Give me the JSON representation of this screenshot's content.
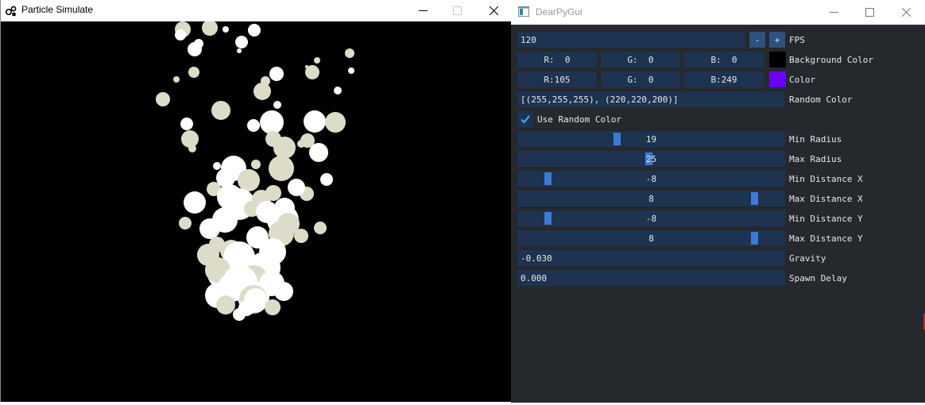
{
  "left_window": {
    "title": "Particle Simulate",
    "controls": [
      "minimize",
      "maximize",
      "close"
    ]
  },
  "right_window": {
    "title": "DearPyGui",
    "fps": {
      "value": "120",
      "minus_label": "-",
      "plus_label": "+",
      "label": "FPS"
    },
    "background_color": {
      "r": "R:  0",
      "g": "G:  0",
      "b": "B:  0",
      "swatch": "#000000",
      "label": "Background Color"
    },
    "color": {
      "r": "R:105",
      "g": "G:  0",
      "b": "B:249",
      "swatch": "#6900f9",
      "label": "Color"
    },
    "random_color": {
      "value": "[(255,255,255), (220,220,200)]",
      "label": "Random Color"
    },
    "use_random_color": {
      "checked": true,
      "label": "Use Random Color"
    },
    "sliders": [
      {
        "value": "19",
        "label": "Min Radius",
        "min": 1,
        "max": 50
      },
      {
        "value": "25",
        "label": "Max Radius",
        "min": 1,
        "max": 50
      },
      {
        "value": "-8",
        "label": "Min Distance X",
        "min": -10,
        "max": 10
      },
      {
        "value": "8",
        "label": "Max Distance X",
        "min": -10,
        "max": 10
      },
      {
        "value": "-8",
        "label": "Min Distance Y",
        "min": -10,
        "max": 10
      },
      {
        "value": "8",
        "label": "Max Distance Y",
        "min": -10,
        "max": 10
      }
    ],
    "gravity": {
      "value": "-0.030",
      "label": "Gravity"
    },
    "spawn_delay": {
      "value": "0.000",
      "label": "Spawn Delay"
    }
  },
  "colors": {
    "particle_white": "#ffffff",
    "particle_beige": "#dcdcc8",
    "canvas_bg": "#000000",
    "panel_bg": "#25282d",
    "frame_bg": "#1d3350",
    "grab": "#3e79d6",
    "button": "#2d5181"
  }
}
